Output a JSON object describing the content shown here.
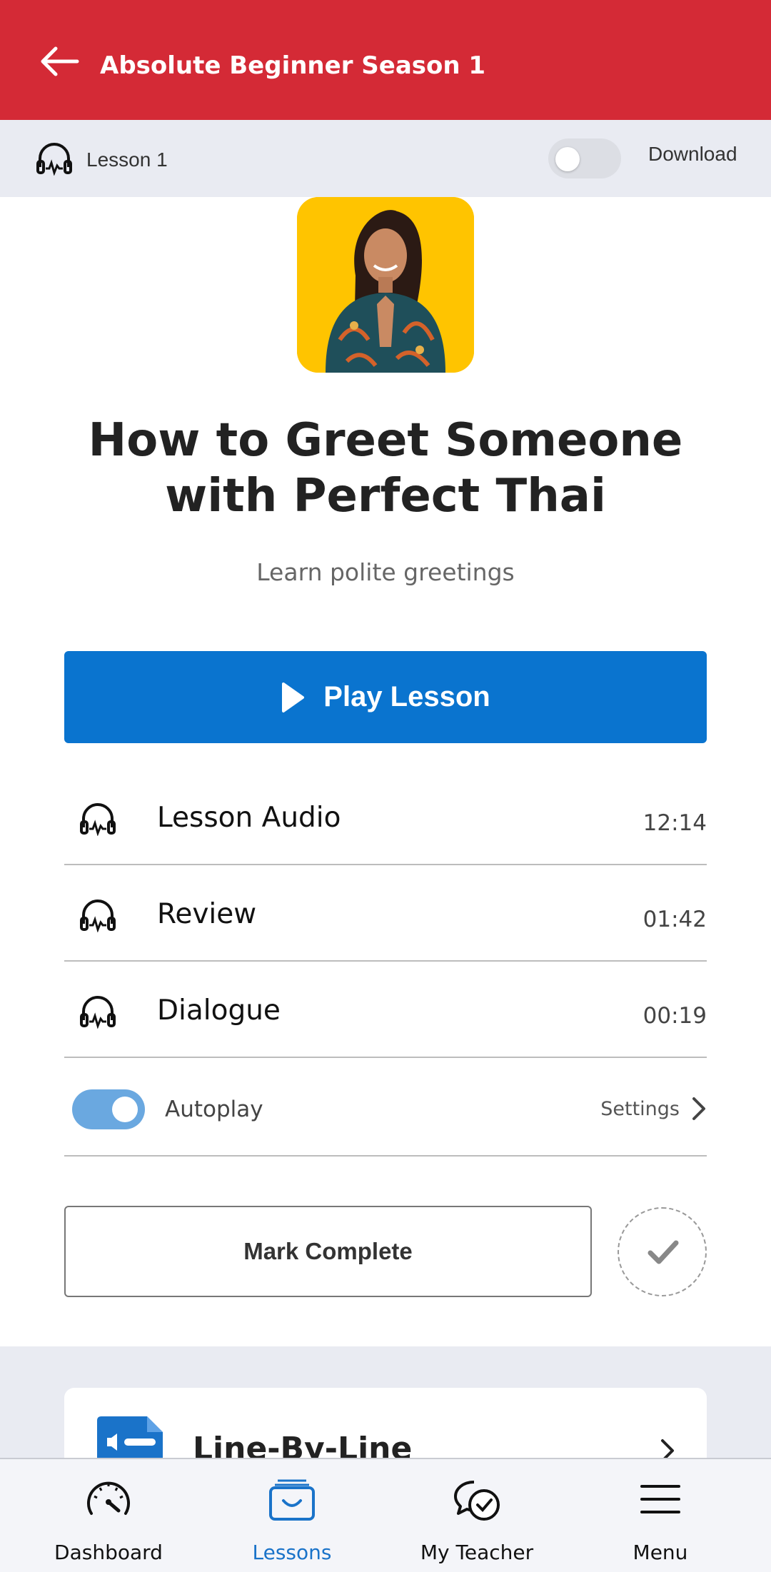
{
  "header": {
    "title": "Absolute Beginner Season 1",
    "background_color": "#d42a36",
    "back_icon": "arrow-left-icon"
  },
  "lesson_bar": {
    "label": "Lesson 1",
    "icon": "headphones-icon",
    "download_label": "Download",
    "download_enabled": false
  },
  "lesson": {
    "title": "How to Greet Someone with Perfect Thai",
    "subtitle": "Learn polite greetings"
  },
  "play_button": {
    "label": "Play Lesson",
    "color": "#0a74cf",
    "icon": "play-icon"
  },
  "audio_tracks": [
    {
      "label": "Lesson Audio",
      "duration": "12:14"
    },
    {
      "label": "Review",
      "duration": "01:42"
    },
    {
      "label": "Dialogue",
      "duration": "00:19"
    }
  ],
  "autoplay": {
    "label": "Autoplay",
    "enabled": true,
    "settings_label": "Settings"
  },
  "mark_complete": {
    "label": "Mark Complete"
  },
  "next_card": {
    "title": "Line-By-Line",
    "icon": "document-audio-icon"
  },
  "bottom_nav": {
    "items": [
      {
        "label": "Dashboard",
        "icon": "speedometer-icon",
        "active": false
      },
      {
        "label": "Lessons",
        "icon": "inbox-icon",
        "active": true
      },
      {
        "label": "My Teacher",
        "icon": "chat-bubbles-icon",
        "active": false
      },
      {
        "label": "Menu",
        "icon": "hamburger-icon",
        "active": false
      }
    ],
    "active_color": "#1a73c9"
  }
}
